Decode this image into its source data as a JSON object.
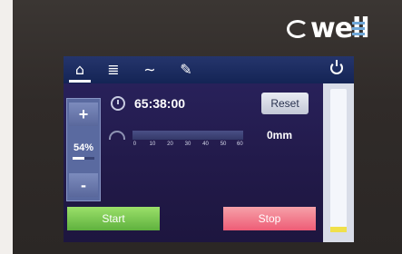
{
  "brand": {
    "name": "well",
    "accent": "#6fa7d8"
  },
  "toolbar": {
    "tabs": [
      {
        "name": "home-tab",
        "icon": "home-icon",
        "glyph": "⌂"
      },
      {
        "name": "settings-tab",
        "icon": "sliders-icon",
        "glyph": "≣"
      },
      {
        "name": "graph-tab",
        "icon": "graph-icon",
        "glyph": "∼"
      },
      {
        "name": "tools-tab",
        "icon": "wrench-icon",
        "glyph": "✎"
      }
    ],
    "power_icon": "power-icon"
  },
  "speed_control": {
    "plus_label": "+",
    "minus_label": "-",
    "value": "54%",
    "fill_percent": 54
  },
  "timer": {
    "icon": "timer-icon",
    "value": "65:38:00",
    "reset_label": "Reset"
  },
  "distance_scale": {
    "icon": "gauge-icon",
    "ticks": [
      "0",
      "10",
      "20",
      "30",
      "40",
      "50",
      "60"
    ],
    "value": "0mm"
  },
  "actions": {
    "start_label": "Start",
    "stop_label": "Stop",
    "start_color": "#6fc24b",
    "stop_color": "#ee5c76"
  },
  "side_level": {
    "level_percent": 4,
    "color": "#f0e04a"
  }
}
